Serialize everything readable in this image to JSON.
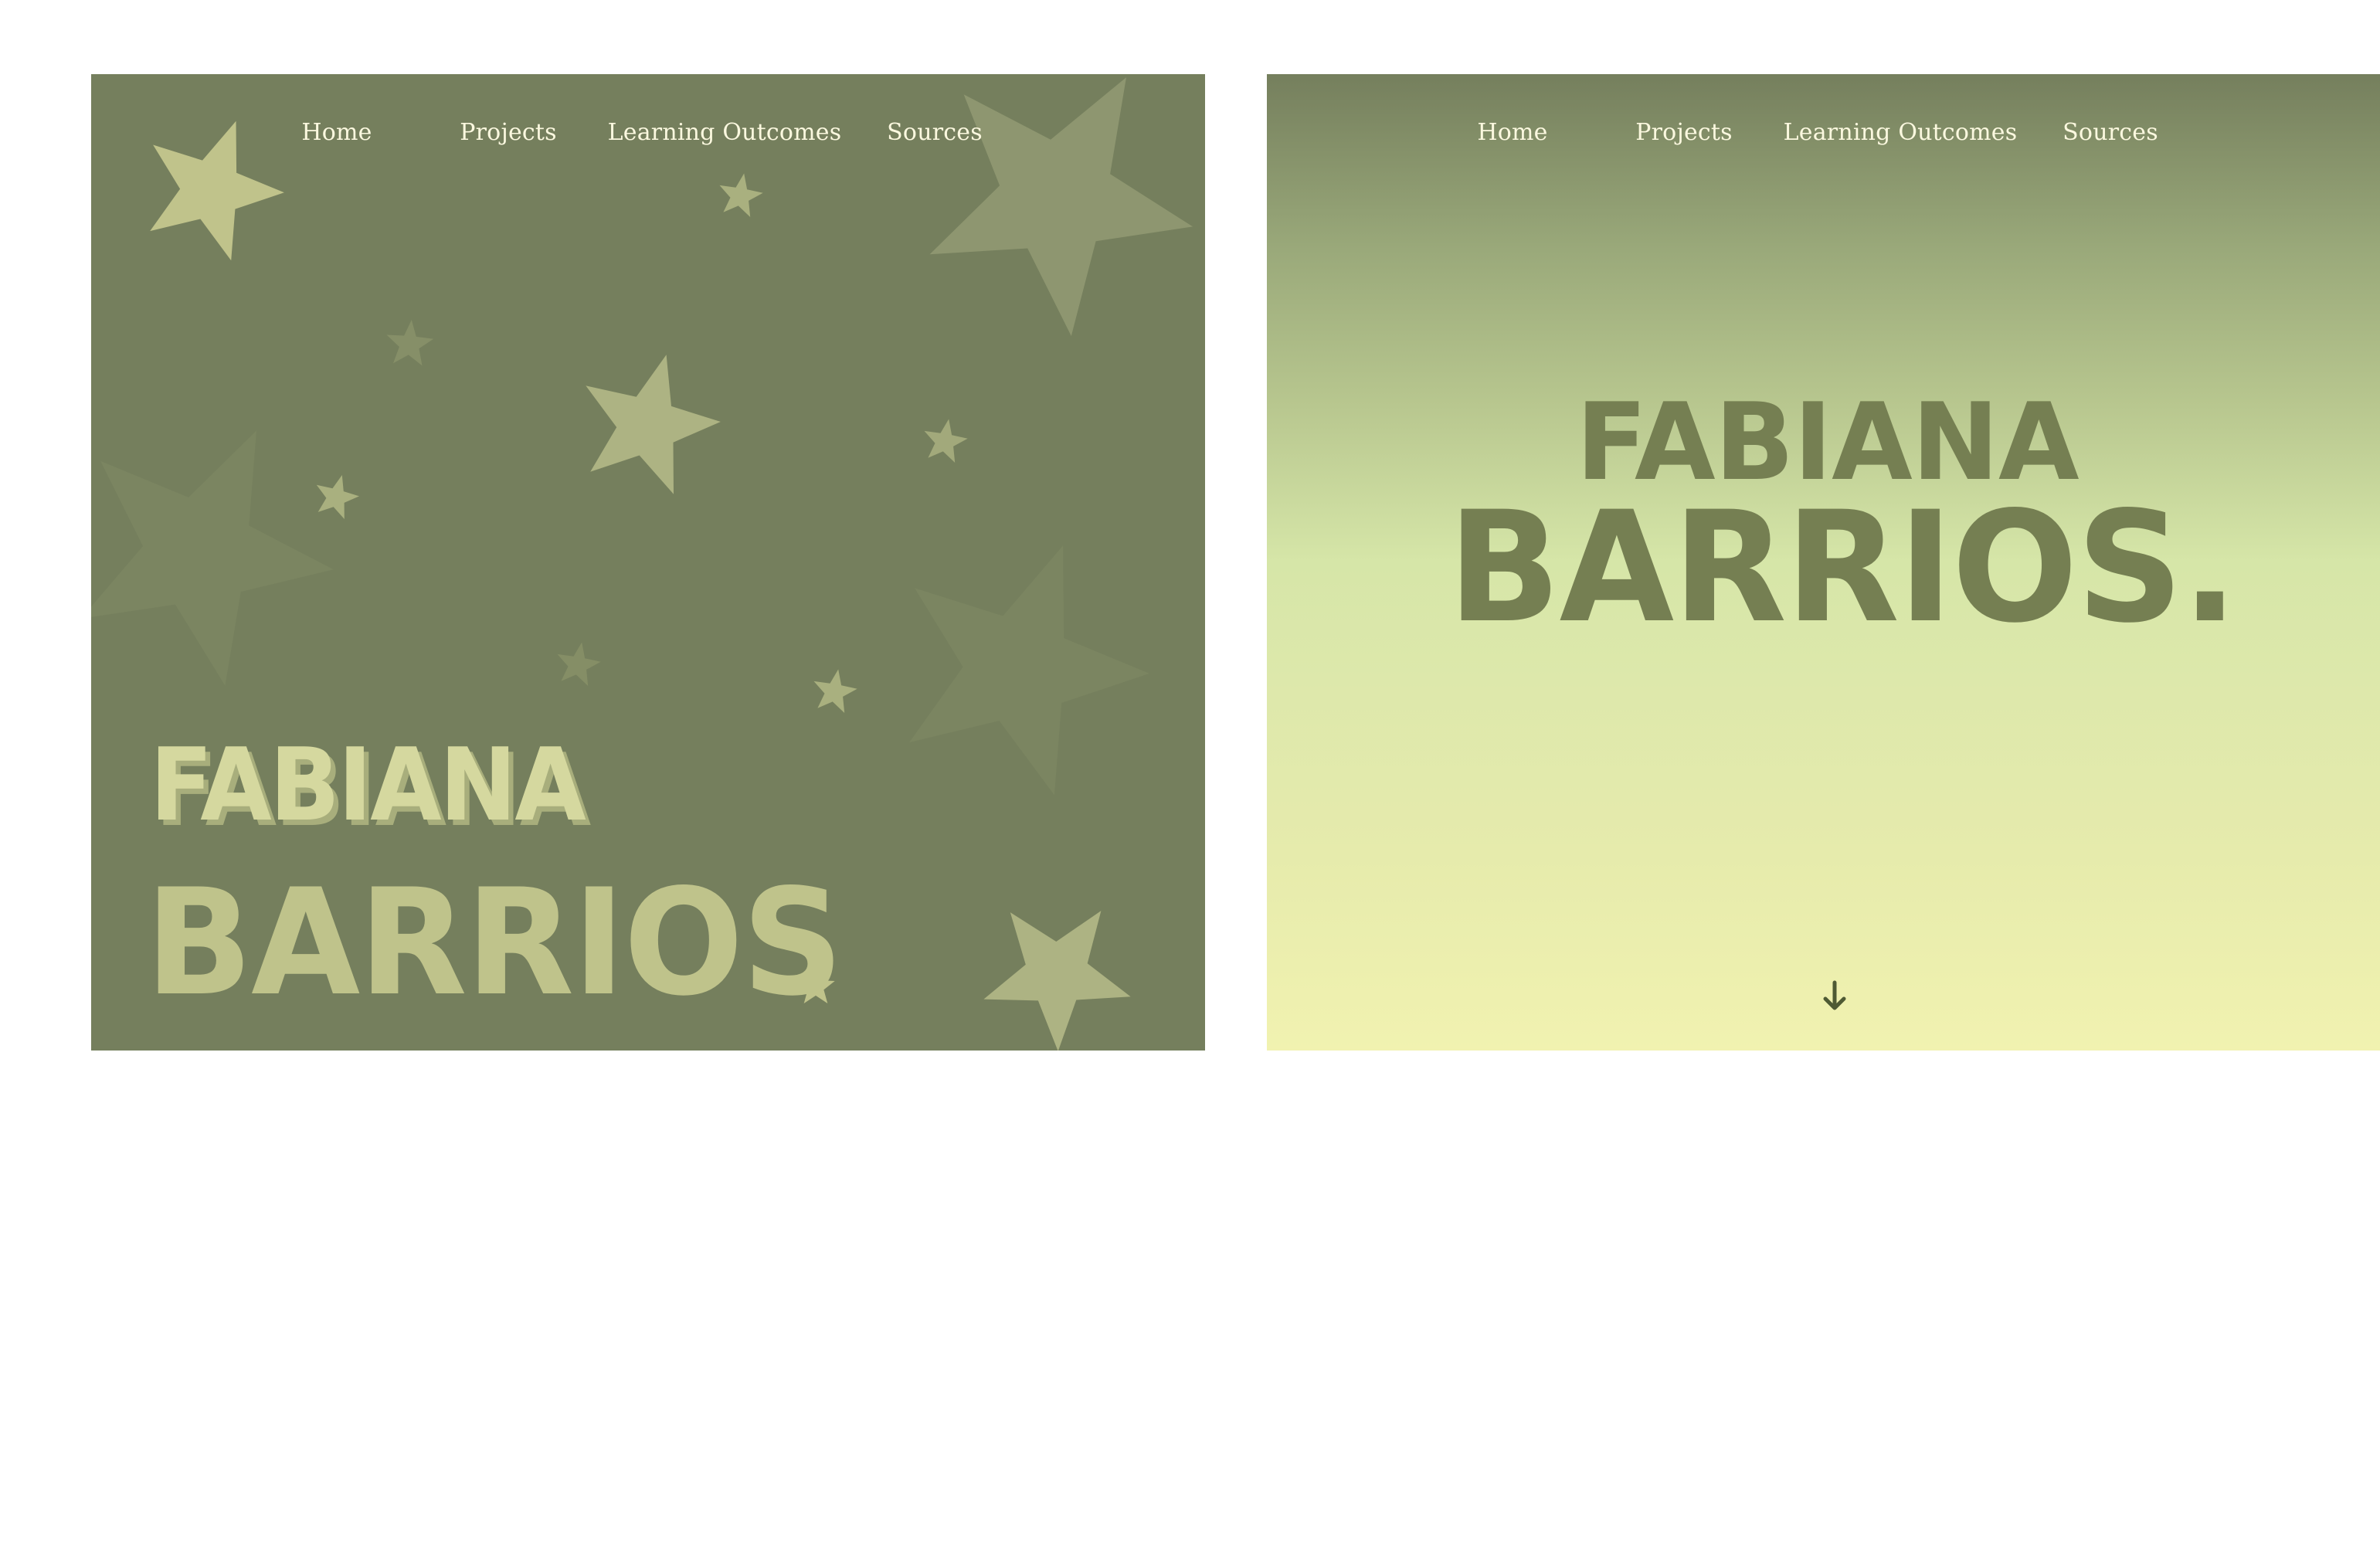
{
  "panels": [
    {
      "id": "stars",
      "nav": [
        "Home",
        "Projects",
        "Learning Outcomes",
        "Sources"
      ],
      "name_first": "FABIANA",
      "name_last": "BARRIOS"
    },
    {
      "id": "gradient",
      "nav": [
        "Home",
        "Projects",
        "Learning Outcomes",
        "Sources"
      ],
      "name_first": "FABIANA",
      "name_last": "BARRIOS.",
      "scroll_icon": "arrow-down-icon"
    }
  ],
  "colors": {
    "olive_bg": "#757f5d",
    "nav_text": "#fbf8df",
    "name_light": "#d5d89f",
    "name_muted": "#bfc38b",
    "name_dark": "#757f52",
    "gradient_bottom": "#f1f2b0",
    "arrow": "#4e5a34"
  }
}
